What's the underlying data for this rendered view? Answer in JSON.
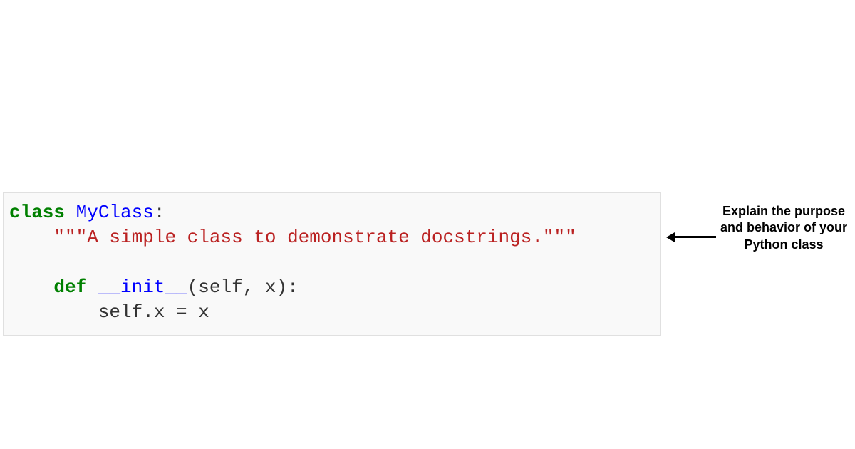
{
  "code": {
    "indent1": "    ",
    "indent2": "        ",
    "line1": {
      "kw": "class",
      "space": " ",
      "name": "MyClass",
      "colon": ":"
    },
    "line2": {
      "docstring": "\"\"\"A simple class to demonstrate docstrings.\"\"\""
    },
    "line3": {
      "empty": ""
    },
    "line4": {
      "kw": "def",
      "space": " ",
      "name": "__init__",
      "params": "(self, x):"
    },
    "line5": {
      "body": "self.x = x"
    }
  },
  "annotation": {
    "text": "Explain the purpose and behavior of your Python class"
  }
}
